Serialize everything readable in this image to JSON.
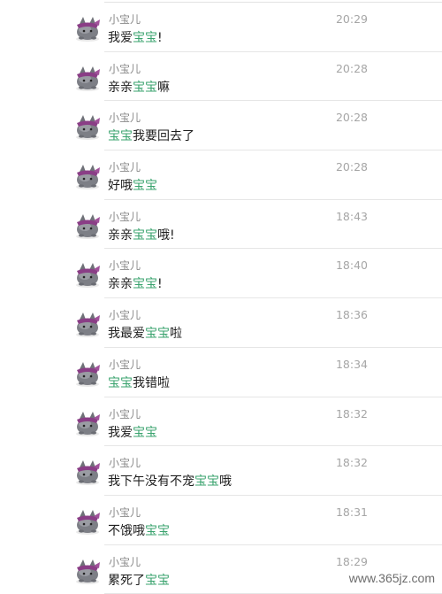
{
  "colors": {
    "highlight": "#3aa36e",
    "text": "#1e1e1e",
    "meta": "#8a8a8a",
    "time": "#a6a6a6",
    "divider": "#e6e6e6"
  },
  "avatar_icon": "gray-cat-with-purple-bow-icon",
  "messages": [
    {
      "sender": "小宝儿",
      "time": "20:29",
      "parts": [
        {
          "t": "我爱"
        },
        {
          "t": "宝宝",
          "hl": true
        },
        {
          "t": "!"
        }
      ]
    },
    {
      "sender": "小宝儿",
      "time": "20:28",
      "parts": [
        {
          "t": "亲亲"
        },
        {
          "t": "宝宝",
          "hl": true
        },
        {
          "t": "嘛"
        }
      ]
    },
    {
      "sender": "小宝儿",
      "time": "20:28",
      "parts": [
        {
          "t": "宝宝",
          "hl": true
        },
        {
          "t": "我要回去了"
        }
      ]
    },
    {
      "sender": "小宝儿",
      "time": "20:28",
      "parts": [
        {
          "t": "好哦"
        },
        {
          "t": "宝宝",
          "hl": true
        }
      ]
    },
    {
      "sender": "小宝儿",
      "time": "18:43",
      "parts": [
        {
          "t": "亲亲"
        },
        {
          "t": "宝宝",
          "hl": true
        },
        {
          "t": "哦!"
        }
      ]
    },
    {
      "sender": "小宝儿",
      "time": "18:40",
      "parts": [
        {
          "t": "亲亲"
        },
        {
          "t": "宝宝",
          "hl": true
        },
        {
          "t": "!"
        }
      ]
    },
    {
      "sender": "小宝儿",
      "time": "18:36",
      "parts": [
        {
          "t": "我最爱"
        },
        {
          "t": "宝宝",
          "hl": true
        },
        {
          "t": "啦"
        }
      ]
    },
    {
      "sender": "小宝儿",
      "time": "18:34",
      "parts": [
        {
          "t": "宝宝",
          "hl": true
        },
        {
          "t": "我错啦"
        }
      ]
    },
    {
      "sender": "小宝儿",
      "time": "18:32",
      "parts": [
        {
          "t": "我爱"
        },
        {
          "t": "宝宝",
          "hl": true
        }
      ]
    },
    {
      "sender": "小宝儿",
      "time": "18:32",
      "parts": [
        {
          "t": "我下午没有不宠"
        },
        {
          "t": "宝宝",
          "hl": true
        },
        {
          "t": "哦"
        }
      ]
    },
    {
      "sender": "小宝儿",
      "time": "18:31",
      "parts": [
        {
          "t": "不饿哦"
        },
        {
          "t": "宝宝",
          "hl": true
        }
      ]
    },
    {
      "sender": "小宝儿",
      "time": "18:29",
      "parts": [
        {
          "t": "累死了"
        },
        {
          "t": "宝宝",
          "hl": true
        }
      ]
    }
  ],
  "watermark": "www.365jz.com"
}
